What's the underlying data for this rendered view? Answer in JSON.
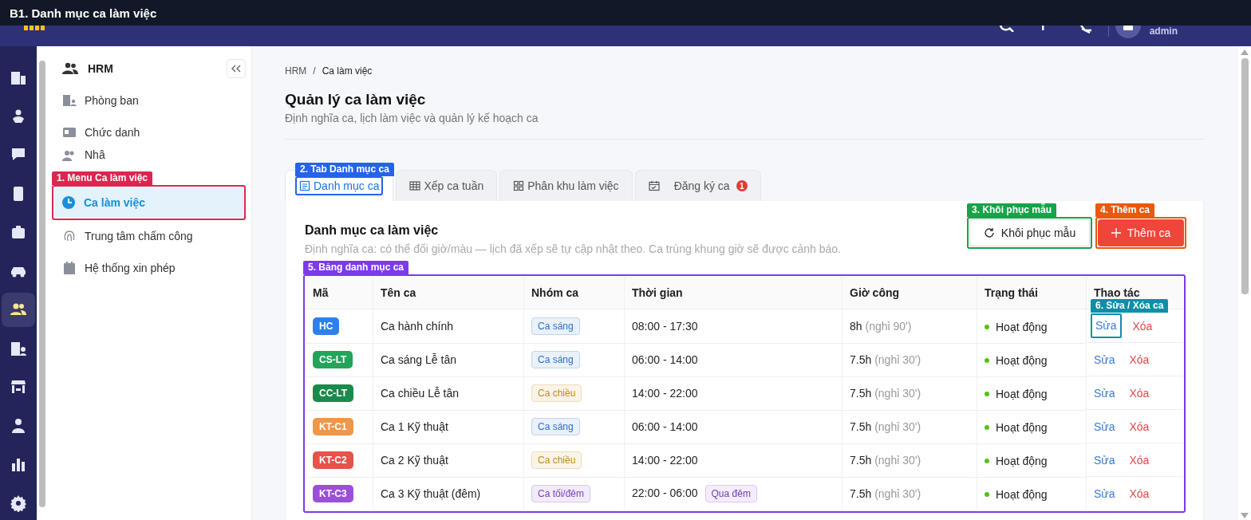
{
  "title_bar": {
    "title": "B1. Danh mục ca làm việc"
  },
  "header": {
    "user": "admin"
  },
  "rail": [
    {
      "selected": false
    },
    {
      "selected": false
    },
    {
      "selected": false
    },
    {
      "selected": false
    },
    {
      "selected": false
    },
    {
      "selected": false
    },
    {
      "selected": true
    },
    {
      "selected": false
    },
    {
      "selected": false
    },
    {
      "selected": false
    },
    {
      "selected": false
    },
    {
      "selected": false
    }
  ],
  "sidebar": {
    "title": "HRM",
    "items": [
      {
        "label": "Phòng ban",
        "selected": false
      },
      {
        "label": "Chức danh",
        "selected": false
      },
      {
        "label": "Nhâ",
        "selected": false
      },
      {
        "label": "Ca làm việc",
        "selected": true,
        "callout": {
          "label": "1. Menu Ca làm việc",
          "color": "#dc2650"
        }
      },
      {
        "label": "Trung tâm chấm công",
        "selected": false
      },
      {
        "label": "Hệ thống xin phép",
        "selected": false
      }
    ]
  },
  "breadcrumb": {
    "separator": "/",
    "items": [
      "HRM",
      "Ca làm việc"
    ]
  },
  "page": {
    "title": "Quản lý ca làm việc",
    "subtitle": "Định nghĩa ca, lịch làm việc và quản lý kế hoạch ca"
  },
  "tabs": [
    {
      "label": "Danh mục ca",
      "selected": true,
      "callout": {
        "label": "2. Tab Danh mục ca",
        "color": "#2563eb"
      }
    },
    {
      "label": "Xếp ca tuần",
      "selected": false
    },
    {
      "label": "Phân khu làm việc",
      "selected": false
    },
    {
      "label": "Đăng ký ca",
      "selected": false,
      "badge": "1"
    }
  ],
  "section": {
    "title": "Danh mục ca làm việc",
    "description": "Định nghĩa ca: có thể đổi giờ/màu — lịch đã xếp sẽ tự cập nhật theo. Ca trùng khung giờ sẽ được cảnh báo.",
    "buttons": [
      {
        "kind": "secondary",
        "label": "Khôi phục mẫu",
        "callout": {
          "label": "3. Khôi phục mẫu",
          "color": "#16a34a"
        }
      },
      {
        "kind": "primary",
        "label": "Thêm ca",
        "callout": {
          "label": "4. Thêm ca",
          "color": "#ea580c"
        }
      }
    ]
  },
  "table": {
    "callout": {
      "label": "5. Bảng danh mục ca",
      "color": "#7c3aed"
    },
    "columns": [
      "Mã",
      "Tên ca",
      "Nhóm ca",
      "Thời gian",
      "Giờ công",
      "Trạng thái",
      "Thao tác"
    ],
    "rows": [
      {
        "code": {
          "text": "HC",
          "color": "#2f80ed"
        },
        "name": "Ca hành chính",
        "group": {
          "text": "Ca sáng",
          "color": "#2f6fd0"
        },
        "time": "08:00 - 17:30",
        "hours": "8h",
        "break": "(nghỉ 90')",
        "status": "Hoạt động",
        "active": true,
        "edit": "Sửa",
        "delete": "Xóa",
        "edit_callout": {
          "label": "6. Sửa / Xóa ca",
          "color": "#0e8fa8"
        }
      },
      {
        "code": {
          "text": "CS-LT",
          "color": "#22a55a"
        },
        "name": "Ca sáng Lễ tân",
        "group": {
          "text": "Ca sáng",
          "color": "#2f6fd0"
        },
        "time": "06:00 - 14:00",
        "hours": "7.5h",
        "break": "(nghỉ 30')",
        "status": "Hoạt động",
        "active": true,
        "edit": "Sửa",
        "delete": "Xóa"
      },
      {
        "code": {
          "text": "CC-LT",
          "color": "#1c8a4c"
        },
        "name": "Ca chiều Lễ tân",
        "group": {
          "text": "Ca chiều",
          "color": "#c98a1a"
        },
        "time": "14:00 - 22:00",
        "hours": "7.5h",
        "break": "(nghỉ 30')",
        "status": "Hoạt động",
        "active": true,
        "edit": "Sửa",
        "delete": "Xóa"
      },
      {
        "code": {
          "text": "KT-C1",
          "color": "#f0964a"
        },
        "name": "Ca 1 Kỹ thuật",
        "group": {
          "text": "Ca sáng",
          "color": "#2f6fd0"
        },
        "time": "06:00 - 14:00",
        "hours": "7.5h",
        "break": "(nghỉ 30')",
        "status": "Hoạt động",
        "active": true,
        "edit": "Sửa",
        "delete": "Xóa"
      },
      {
        "code": {
          "text": "KT-C2",
          "color": "#e5534b"
        },
        "name": "Ca 2 Kỹ thuật",
        "group": {
          "text": "Ca chiều",
          "color": "#c98a1a"
        },
        "time": "14:00 - 22:00",
        "hours": "7.5h",
        "break": "(nghỉ 30')",
        "status": "Hoạt động",
        "active": true,
        "edit": "Sửa",
        "delete": "Xóa"
      },
      {
        "code": {
          "text": "KT-C3",
          "color": "#9b4fd9"
        },
        "name": "Ca 3 Kỹ thuật (đêm)",
        "group": {
          "text": "Ca tối/đêm",
          "color": "#7b3fc4"
        },
        "time": "22:00 - 06:00",
        "time_tag": "Qua đêm",
        "hours": "7.5h",
        "break": "(nghỉ 30')",
        "status": "Hoạt động",
        "active": true,
        "edit": "Sửa",
        "delete": "Xóa"
      }
    ]
  }
}
